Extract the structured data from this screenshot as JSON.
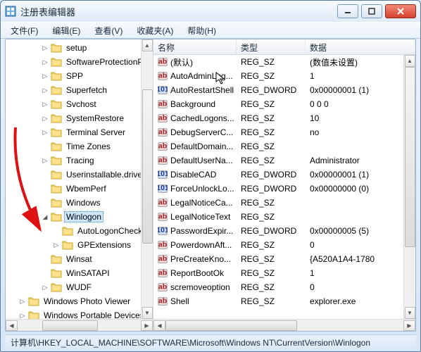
{
  "titlebar": {
    "title": "注册表编辑器"
  },
  "menu": {
    "file": "文件(F)",
    "edit": "编辑(E)",
    "view": "查看(V)",
    "fav": "收藏夹(A)",
    "help": "帮助(H)"
  },
  "tree": {
    "items": [
      {
        "indent": 2,
        "exp": "▷",
        "label": "setup"
      },
      {
        "indent": 2,
        "exp": "▷",
        "label": "SoftwareProtectionPla"
      },
      {
        "indent": 2,
        "exp": "▷",
        "label": "SPP"
      },
      {
        "indent": 2,
        "exp": "▷",
        "label": "Superfetch"
      },
      {
        "indent": 2,
        "exp": "▷",
        "label": "Svchost"
      },
      {
        "indent": 2,
        "exp": "▷",
        "label": "SystemRestore"
      },
      {
        "indent": 2,
        "exp": "▷",
        "label": "Terminal Server"
      },
      {
        "indent": 2,
        "exp": "",
        "label": "Time Zones"
      },
      {
        "indent": 2,
        "exp": "▷",
        "label": "Tracing"
      },
      {
        "indent": 2,
        "exp": "",
        "label": "Userinstallable.drivers"
      },
      {
        "indent": 2,
        "exp": "",
        "label": "WbemPerf"
      },
      {
        "indent": 2,
        "exp": "",
        "label": "Windows"
      },
      {
        "indent": 2,
        "exp": "◢",
        "label": "Winlogon",
        "selected": true
      },
      {
        "indent": 3,
        "exp": "",
        "label": "AutoLogonChecke"
      },
      {
        "indent": 3,
        "exp": "▷",
        "label": "GPExtensions"
      },
      {
        "indent": 2,
        "exp": "",
        "label": "Winsat"
      },
      {
        "indent": 2,
        "exp": "",
        "label": "WinSATAPI"
      },
      {
        "indent": 2,
        "exp": "▷",
        "label": "WUDF"
      },
      {
        "indent": 0,
        "exp": "▷",
        "label": "Windows Photo Viewer"
      },
      {
        "indent": 0,
        "exp": "▷",
        "label": "Windows Portable Devices"
      }
    ]
  },
  "columns": {
    "name": "名称",
    "type": "类型",
    "data": "数据"
  },
  "rows": [
    {
      "icon": "sz",
      "name": "(默认)",
      "type": "REG_SZ",
      "data": "(数值未设置)"
    },
    {
      "icon": "sz",
      "name": "AutoAdminLog...",
      "type": "REG_SZ",
      "data": "1"
    },
    {
      "icon": "dw",
      "name": "AutoRestartShell",
      "type": "REG_DWORD",
      "data": "0x00000001 (1)"
    },
    {
      "icon": "sz",
      "name": "Background",
      "type": "REG_SZ",
      "data": "0 0 0"
    },
    {
      "icon": "sz",
      "name": "CachedLogons...",
      "type": "REG_SZ",
      "data": "10"
    },
    {
      "icon": "sz",
      "name": "DebugServerC...",
      "type": "REG_SZ",
      "data": "no"
    },
    {
      "icon": "sz",
      "name": "DefaultDomain...",
      "type": "REG_SZ",
      "data": ""
    },
    {
      "icon": "sz",
      "name": "DefaultUserNa...",
      "type": "REG_SZ",
      "data": "Administrator"
    },
    {
      "icon": "dw",
      "name": "DisableCAD",
      "type": "REG_DWORD",
      "data": "0x00000001 (1)"
    },
    {
      "icon": "dw",
      "name": "ForceUnlockLo...",
      "type": "REG_DWORD",
      "data": "0x00000000 (0)"
    },
    {
      "icon": "sz",
      "name": "LegalNoticeCa...",
      "type": "REG_SZ",
      "data": ""
    },
    {
      "icon": "sz",
      "name": "LegalNoticeText",
      "type": "REG_SZ",
      "data": ""
    },
    {
      "icon": "dw",
      "name": "PasswordExpir...",
      "type": "REG_DWORD",
      "data": "0x00000005 (5)"
    },
    {
      "icon": "sz",
      "name": "PowerdownAft...",
      "type": "REG_SZ",
      "data": "0"
    },
    {
      "icon": "sz",
      "name": "PreCreateKno...",
      "type": "REG_SZ",
      "data": "{A520A1A4-1780"
    },
    {
      "icon": "sz",
      "name": "ReportBootOk",
      "type": "REG_SZ",
      "data": "1"
    },
    {
      "icon": "sz",
      "name": "scremoveoption",
      "type": "REG_SZ",
      "data": "0"
    },
    {
      "icon": "sz",
      "name": "Shell",
      "type": "REG_SZ",
      "data": "explorer.exe"
    }
  ],
  "status": "计算机\\HKEY_LOCAL_MACHINE\\SOFTWARE\\Microsoft\\Windows NT\\CurrentVersion\\Winlogon"
}
